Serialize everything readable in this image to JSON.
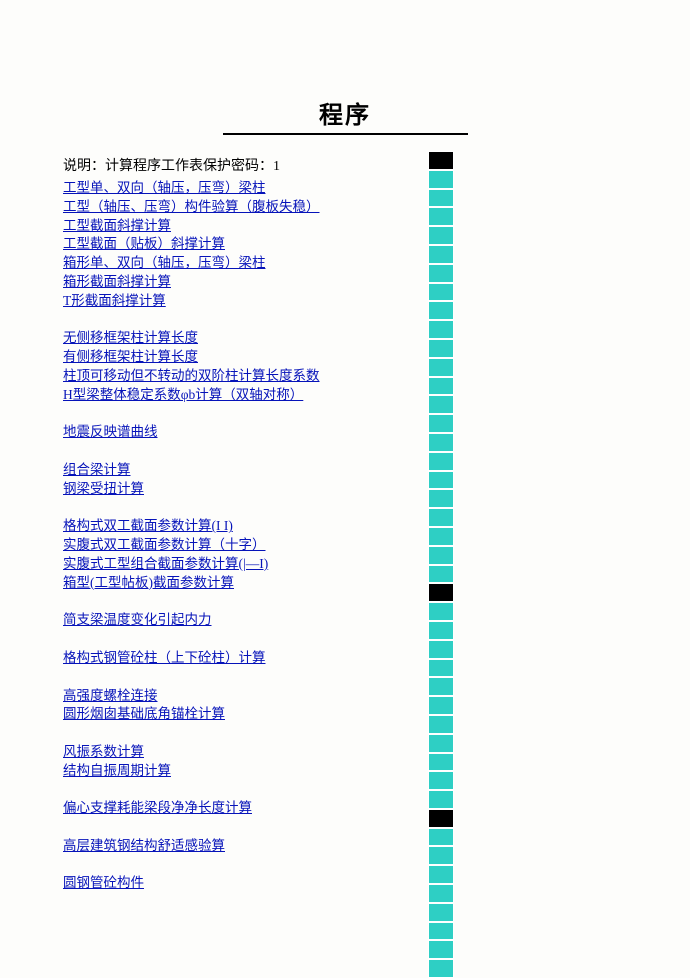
{
  "title": "程序",
  "description": "说明：计算程序工作表保护密码：1",
  "groups": [
    [
      "工型单、双向（轴压，压弯）梁柱",
      "工型（轴压、压弯）构件验算（腹板失稳）",
      "工型截面斜撑计算",
      "工型截面（贴板）斜撑计算",
      "箱形单、双向（轴压，压弯）梁柱",
      "箱形截面斜撑计算",
      "T形截面斜撑计算"
    ],
    [
      "无侧移框架柱计算长度",
      "有侧移框架柱计算长度",
      "柱顶可移动但不转动的双阶柱计算长度系数",
      "H型梁整体稳定系数φb计算（双轴对称）"
    ],
    [
      "地震反映谱曲线"
    ],
    [
      "组合梁计算",
      "钢梁受扭计算"
    ],
    [
      "格构式双工截面参数计算(I   I)",
      "实腹式双工截面参数计算（十字）",
      "实腹式工型组合截面参数计算(|—I)",
      "箱型(工型帖板)截面参数计算"
    ],
    [
      "简支梁温度变化引起内力"
    ],
    [
      "格构式钢管砼柱（上下砼柱）计算"
    ],
    [
      "高强度螺栓连接",
      "圆形烟囱基础底角锚栓计算"
    ],
    [
      "风振系数计算",
      "结构自振周期计算"
    ],
    [
      "偏心支撑耗能梁段净净长度计算"
    ],
    [
      "高层建筑钢结构舒适感验算"
    ],
    [
      "圆钢管砼构件"
    ]
  ],
  "sidebar_cells": [
    "black",
    "teal",
    "teal",
    "teal",
    "teal",
    "teal",
    "teal",
    "teal",
    "teal",
    "teal",
    "teal",
    "teal",
    "teal",
    "teal",
    "teal",
    "teal",
    "teal",
    "teal",
    "teal",
    "teal",
    "teal",
    "teal",
    "teal",
    "black",
    "teal",
    "teal",
    "teal",
    "teal",
    "teal",
    "teal",
    "teal",
    "teal",
    "teal",
    "teal",
    "teal",
    "black",
    "teal",
    "teal",
    "teal",
    "teal",
    "teal",
    "teal",
    "teal",
    "teal"
  ]
}
